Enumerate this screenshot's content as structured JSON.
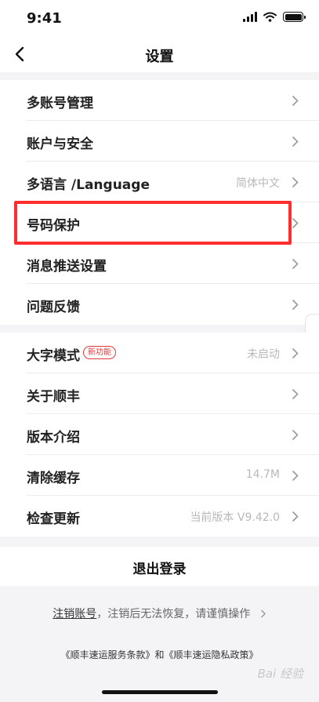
{
  "status": {
    "time": "9:41"
  },
  "nav": {
    "title": "设置"
  },
  "group1": [
    {
      "label": "多账号管理",
      "value": ""
    },
    {
      "label": "账户与安全",
      "value": ""
    },
    {
      "label": "多语言 /Language",
      "value": "简体中文"
    },
    {
      "label": "号码保护",
      "value": ""
    },
    {
      "label": "消息推送设置",
      "value": ""
    },
    {
      "label": "问题反馈",
      "value": ""
    }
  ],
  "group2": [
    {
      "label": "大字模式",
      "badge": "新功能",
      "value": "未启动"
    },
    {
      "label": "关于顺丰",
      "value": ""
    },
    {
      "label": "版本介绍",
      "value": ""
    },
    {
      "label": "清除缓存",
      "value": "14.7M"
    },
    {
      "label": "检查更新",
      "value": "当前版本 V9.42.0"
    }
  ],
  "logout": {
    "label": "退出登录"
  },
  "cancel": {
    "link": "注销账号",
    "text": "，注销后无法恢复，请谨慎操作"
  },
  "policies": {
    "text": "《顺丰速运服务条款》和《顺丰速运隐私政策》"
  },
  "watermark": "Bai 经验",
  "colors": {
    "highlight": "#ff2d2d",
    "badge": "#e23a3a"
  }
}
